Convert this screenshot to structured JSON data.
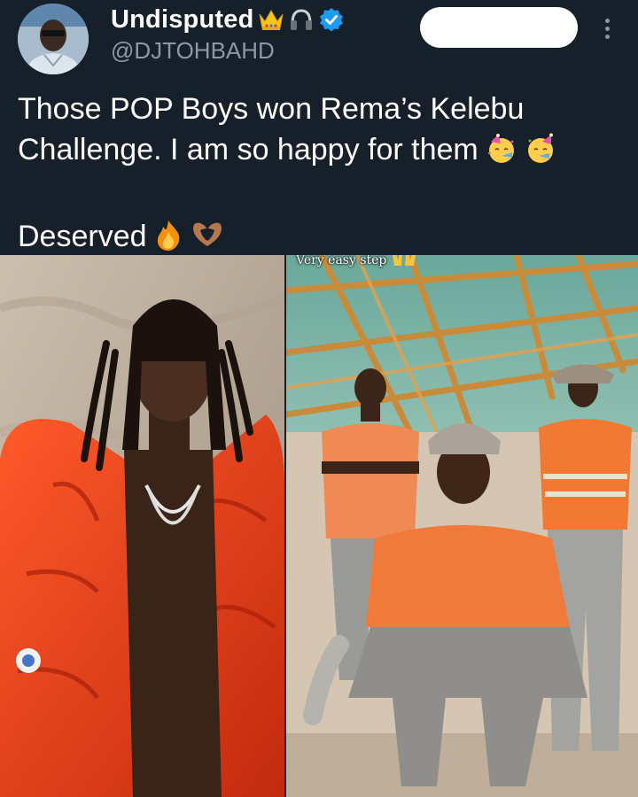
{
  "header": {
    "display_name": "Undisputed",
    "handle": "@DJTOHBAHD",
    "badges": [
      "crown-icon",
      "headphones-icon",
      "verified-badge-icon"
    ],
    "follow_button_label": "",
    "more_icon": "more-vertical-icon"
  },
  "tweet": {
    "line1": "Those POP Boys won Rema’s Kelebu",
    "line2": "Challenge. I am so happy for them",
    "line2_emojis": [
      "partying-face-icon",
      "partying-face-icon"
    ],
    "line3": "Deserved",
    "line3_emojis": [
      "fire-icon",
      "heart-hands-icon"
    ]
  },
  "media": {
    "right_caption": "Very easy step",
    "right_caption_emoji": "raising-hands-icon"
  },
  "colors": {
    "background": "#15202b",
    "text": "#ffffff",
    "secondary_text": "#8b98a5",
    "verified": "#1d9bf0",
    "crown": "#f5c518"
  }
}
